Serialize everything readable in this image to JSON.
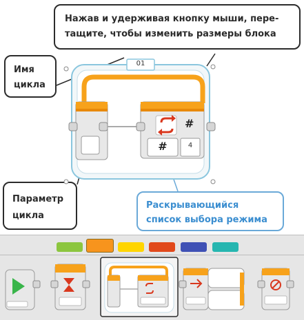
{
  "callouts": {
    "resize": {
      "line1": "Нажав и удерживая кнопку мыши, пере-",
      "line2": "тащите, чтобы изменить размеры блока"
    },
    "loop_name": {
      "line1": "Имя",
      "line2": "цикла"
    },
    "loop_param": {
      "line1": "Параметр",
      "line2": "цикла"
    },
    "mode_list": {
      "line1": "Раскрывающийся",
      "line2": "список выбора режима"
    }
  },
  "loop_block": {
    "name": "01",
    "mode_symbol": "#",
    "count_value": "4",
    "output_symbol": "#"
  },
  "palette": {
    "tabs": [
      {
        "name": "action",
        "color": "#8cc63f"
      },
      {
        "name": "flow-control",
        "color": "#f7941d",
        "selected": true
      },
      {
        "name": "sensor",
        "color": "#ffd500"
      },
      {
        "name": "data-operations",
        "color": "#e1491b"
      },
      {
        "name": "advanced",
        "color": "#3f51b5"
      },
      {
        "name": "my-blocks",
        "color": "#26b6b0"
      }
    ],
    "blocks": [
      "start",
      "wait",
      "loop",
      "switch",
      "loop-interrupt"
    ]
  },
  "colors": {
    "accent_orange": "#f7a21b",
    "callout_blue": "#3b8ed0",
    "loop_frame": "#8ac6de"
  }
}
